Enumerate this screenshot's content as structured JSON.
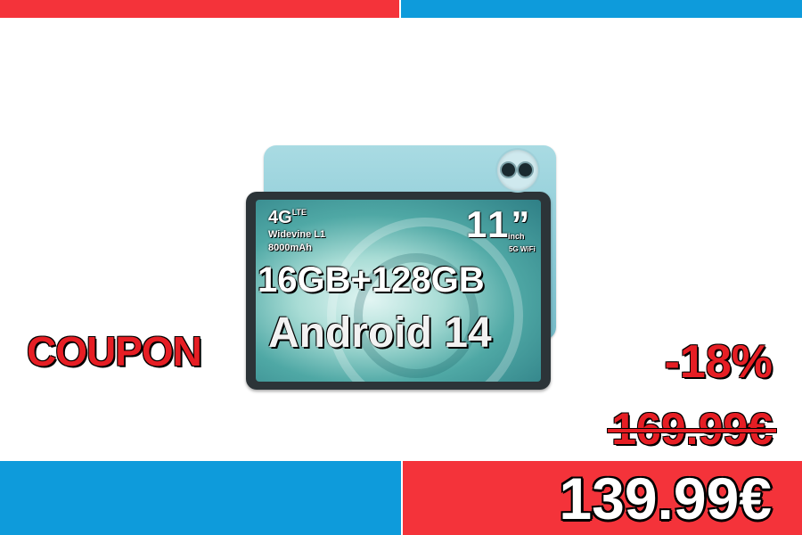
{
  "colors": {
    "red": "#f4333a",
    "blue": "#0e9bdb",
    "white": "#ffffff"
  },
  "coupon_label": "COUPON",
  "discount": "-18%",
  "old_price": "169.99€",
  "new_price": "139.99€",
  "product": {
    "network": "4G",
    "network_sub": "LTE",
    "drm": "Widevine L1",
    "battery": "8000mAh",
    "screen_size": "11”",
    "screen_unit": "inch",
    "wifi": "5G WiFi",
    "memory": "16GB+128GB",
    "os": "Android 14"
  }
}
